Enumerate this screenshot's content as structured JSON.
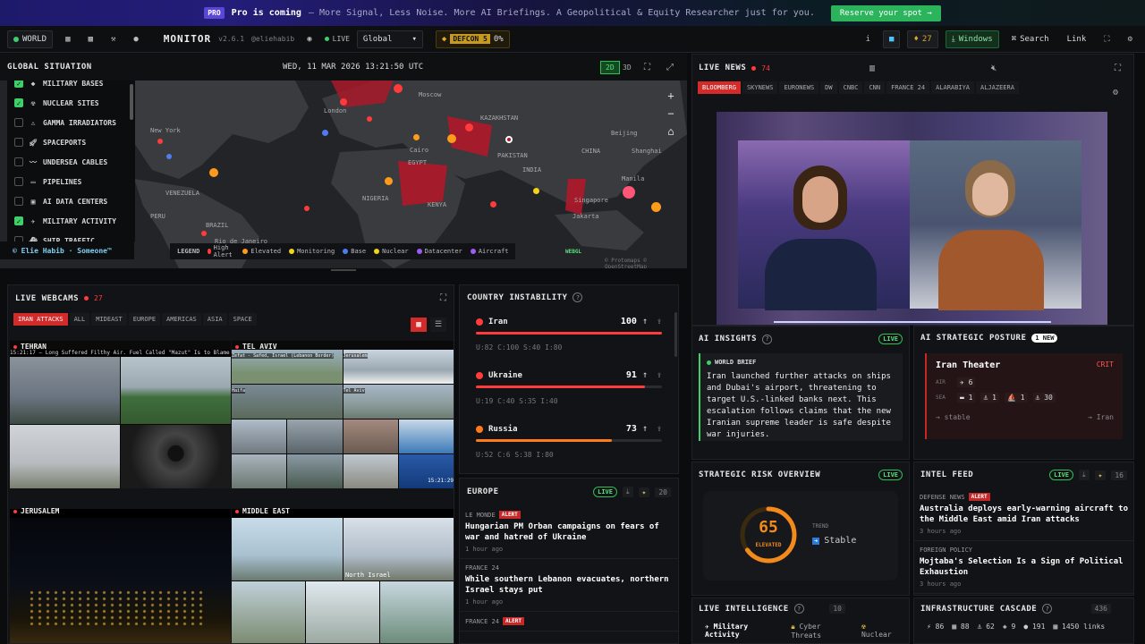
{
  "promo": {
    "badge": "PRO",
    "lead": "Pro is coming",
    "text": "— More Signal, Less Noise. More AI Briefings. A Geopolitical & Equity Researcher just for you.",
    "cta": "Reserve your spot →"
  },
  "topbar": {
    "world": "WORLD",
    "brand": "MONITOR",
    "version": "v2.6.1",
    "handle": "@eliehabib",
    "live": "LIVE",
    "region": "Global",
    "defcon": "DEFCON 5",
    "defcon_pct": "0%",
    "info": "i",
    "streak": "27",
    "windows": "Windows",
    "search": "Search",
    "link": "Link"
  },
  "map": {
    "title": "GLOBAL SITUATION",
    "timestamp": "WED, 11 MAR 2026 13:21:50 UTC",
    "mode_2d": "2D",
    "mode_3d": "3D",
    "layers": [
      {
        "label": "MILITARY BASES",
        "checked": true
      },
      {
        "label": "NUCLEAR SITES",
        "checked": true
      },
      {
        "label": "GAMMA IRRADIATORS",
        "checked": false
      },
      {
        "label": "SPACEPORTS",
        "checked": false
      },
      {
        "label": "UNDERSEA CABLES",
        "checked": false
      },
      {
        "label": "PIPELINES",
        "checked": false
      },
      {
        "label": "AI DATA CENTERS",
        "checked": false
      },
      {
        "label": "MILITARY ACTIVITY",
        "checked": true
      },
      {
        "label": "SHIP TRAFFIC",
        "checked": false
      }
    ],
    "credit": "© Elie Habib · Someone™",
    "legend_title": "LEGEND",
    "legend": [
      {
        "label": "High Alert",
        "color": "#ff3b3b"
      },
      {
        "label": "Elevated",
        "color": "#ff9b1a"
      },
      {
        "label": "Monitoring",
        "color": "#f2d21b"
      },
      {
        "label": "Base",
        "color": "#4f7cf0"
      },
      {
        "label": "Nuclear",
        "color": "#f2d21b"
      },
      {
        "label": "Datacenter",
        "color": "#9b5cf0"
      },
      {
        "label": "Aircraft",
        "color": "#9b5cf0"
      }
    ],
    "webgl": "WEBGL",
    "attribution": "© Protomaps © OpenStreetMap",
    "places": [
      "Moscow",
      "KAZAKHSTAN",
      "London",
      "New York",
      "CHINA",
      "Beijing",
      "Shanghai",
      "PAKISTAN",
      "INDIA",
      "Manila",
      "Singapore",
      "Jakarta",
      "EGYPT",
      "KENYA",
      "VENEZUELA",
      "BRAZIL",
      "PERU",
      "Rio de Janeiro",
      "NIGERIA",
      "Cairo"
    ]
  },
  "webcams": {
    "title": "LIVE WEBCAMS",
    "count": "27",
    "tabs": [
      "IRAN ATTACKS",
      "ALL",
      "MIDEAST",
      "EUROPE",
      "AMERICAS",
      "ASIA",
      "SPACE"
    ],
    "groups": [
      "TEHRAN",
      "TEL AVIV",
      "JERUSALEM",
      "MIDDLE EAST"
    ],
    "ticker": "15:21:17 — Long Suffered Filthy Air. Fuel Called \"Mazut\" Is to Blame. The low-grade",
    "overlays": [
      "Zefat - Safed, Israel (Lebanon Border)",
      "Jerusalem",
      "Haifa",
      "Tel Aviv",
      "North Israel"
    ],
    "time": "15:21:29"
  },
  "instability": {
    "title": "COUNTRY INSTABILITY",
    "rows": [
      {
        "name": "Iran",
        "score": "100",
        "trend": "↑",
        "color": "#ff3b3b",
        "pct": 1.0,
        "sub": "U:82  C:100  S:40  I:80"
      },
      {
        "name": "Ukraine",
        "score": "91",
        "trend": "↑",
        "color": "#ff3b3b",
        "pct": 0.91,
        "sub": "U:19  C:40  S:35  I:40"
      },
      {
        "name": "Russia",
        "score": "73",
        "trend": "↑",
        "color": "#ff7a1a",
        "pct": 0.73,
        "sub": "U:52  C:6  S:38  I:80"
      }
    ]
  },
  "europe": {
    "title": "EUROPE",
    "live": "LIVE",
    "count": "20",
    "items": [
      {
        "source": "LE MONDE",
        "alert": "ALERT",
        "headline": "Hungarian PM Orban campaigns on fears of war and hatred of Ukraine",
        "ago": "1 hour ago"
      },
      {
        "source": "FRANCE 24",
        "alert": "",
        "headline": "While southern Lebanon evacuates, northern Israel stays put",
        "ago": "1 hour ago"
      },
      {
        "source": "FRANCE 24",
        "alert": "ALERT",
        "headline": "",
        "ago": ""
      }
    ]
  },
  "livenews": {
    "title": "LIVE NEWS",
    "count": "74",
    "channels": [
      "BLOOMBERG",
      "SKYNEWS",
      "EURONEWS",
      "DW",
      "CNBC",
      "CNN",
      "FRANCE 24",
      "ALARABIYA",
      "ALJAZEERA"
    ]
  },
  "insights": {
    "title": "AI INSIGHTS",
    "live": "LIVE",
    "brief_label": "WORLD BRIEF",
    "brief": "Iran launched further attacks on ships and Dubai's airport, threatening to target U.S.-linked banks next. This escalation follows claims that the new Iranian supreme leader is safe despite war injuries."
  },
  "posture": {
    "title": "AI STRATEGIC POSTURE",
    "new": "1 NEW",
    "theater": "Iran Theater",
    "level": "CRIT",
    "air_label": "AIR",
    "air_count": "6",
    "sea_label": "SEA",
    "sea": [
      "1",
      "1",
      "1",
      "30"
    ],
    "trend": "→ stable",
    "tag": "→ Iran"
  },
  "risk": {
    "title": "STRATEGIC RISK OVERVIEW",
    "live": "LIVE",
    "score": 65,
    "score_text": "65",
    "level": "ELEVATED",
    "trend_label": "TREND",
    "trend": "Stable"
  },
  "intel": {
    "title": "INTEL FEED",
    "live": "LIVE",
    "count": "16",
    "items": [
      {
        "source": "DEFENSE NEWS",
        "alert": "ALERT",
        "headline": "Australia deploys early-warning aircraft to the Middle East amid Iran attacks",
        "ago": "3 hours ago"
      },
      {
        "source": "FOREIGN POLICY",
        "alert": "",
        "headline": "Mojtaba's Selection Is a Sign of Political Exhaustion",
        "ago": "3 hours ago"
      }
    ]
  },
  "liveintel": {
    "title": "LIVE INTELLIGENCE",
    "count": "10",
    "tabs": [
      "Military Activity",
      "Cyber Threats",
      "Nuclear"
    ]
  },
  "infra": {
    "title": "INFRASTRUCTURE CASCADE",
    "count": "436",
    "stats": [
      "86",
      "88",
      "62",
      "9",
      "191",
      "1450 links"
    ]
  }
}
